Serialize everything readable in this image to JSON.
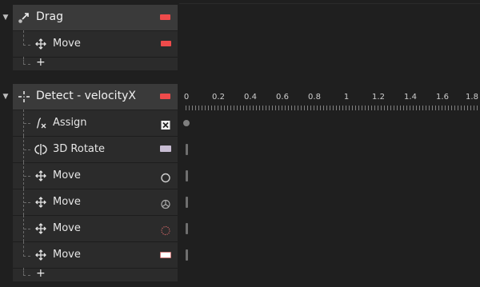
{
  "groups": [
    {
      "title": "Drag",
      "icon": "drag-icon",
      "swatch_color": "#ef4b4b",
      "children": [
        {
          "label": "Move",
          "icon": "move-icon",
          "prop": "red-swatch",
          "color": "#ef4b4b"
        }
      ],
      "add_label": "+"
    },
    {
      "title": "Detect - velocityX",
      "icon": "detect-icon",
      "swatch_color": "#ef4b4b",
      "children": [
        {
          "label": "Assign",
          "icon": "assign-icon",
          "prop": "close-box"
        },
        {
          "label": "3D Rotate",
          "icon": "rotate-3d-icon",
          "prop": "purple-swatch",
          "color": "#c8bdd3"
        },
        {
          "label": "Move",
          "icon": "move-icon",
          "prop": "circle-outline"
        },
        {
          "label": "Move",
          "icon": "move-icon",
          "prop": "dial"
        },
        {
          "label": "Move",
          "icon": "move-icon",
          "prop": "dotted-circle"
        },
        {
          "label": "Move",
          "icon": "move-icon",
          "prop": "white-swatch",
          "color": "#ffffff"
        }
      ],
      "add_label": "+"
    }
  ],
  "ruler": {
    "ticks": [
      "0",
      "0.2",
      "0.4",
      "0.6",
      "0.8",
      "1",
      "1.2",
      "1.4",
      "1.6",
      "1.8"
    ]
  },
  "colors": {
    "accent_red": "#ef4b4b",
    "panel_bg": "#1f1f1f",
    "row_bg": "#2b2b2b",
    "header_bg": "#3a3a3a"
  }
}
